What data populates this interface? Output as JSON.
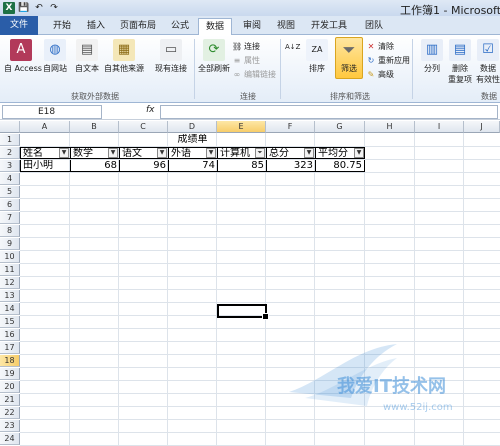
{
  "window": {
    "title": "工作簿1 - Microsoft"
  },
  "tabs": [
    "文件",
    "开始",
    "插入",
    "页面布局",
    "公式",
    "数据",
    "审阅",
    "视图",
    "开发工具",
    "团队"
  ],
  "ribbon": {
    "external": {
      "access": "自 Access",
      "web": "自网站",
      "text": "自文本",
      "other": "自其他来源",
      "existing": "现有连接",
      "group": "获取外部数据"
    },
    "connections": {
      "refresh": "全部刷新",
      "connect": "连接",
      "props": "属性",
      "editlinks": "编辑链接",
      "group": "连接"
    },
    "sort": {
      "sort": "排序",
      "filter": "筛选",
      "clear": "清除",
      "reapply": "重新应用",
      "advanced": "高级",
      "group": "排序和筛选"
    },
    "tools": {
      "split": "分列",
      "dedupe1": "删除",
      "dedupe2": "重复项",
      "valid1": "数据",
      "valid2": "有效性",
      "group": "数据"
    }
  },
  "formula_bar": {
    "cell_ref": "E18",
    "fx": "fx",
    "content": ""
  },
  "columns": [
    "A",
    "B",
    "C",
    "D",
    "E",
    "F",
    "G",
    "H",
    "I",
    "J"
  ],
  "rows": [
    "1",
    "2",
    "3",
    "4",
    "5",
    "6",
    "7",
    "8",
    "9",
    "10",
    "11",
    "12",
    "13",
    "14",
    "15",
    "16",
    "17",
    "18",
    "19",
    "20",
    "21",
    "22",
    "23",
    "24"
  ],
  "sheet": {
    "title": "成绩单",
    "headers": [
      "姓名",
      "数学",
      "语文",
      "外语",
      "计算机",
      "总分",
      "平均分"
    ],
    "row": {
      "name": "田小明",
      "math": "68",
      "chinese": "96",
      "english": "74",
      "computer": "85",
      "total": "323",
      "average": "80.75"
    }
  },
  "watermark": {
    "text": "我爱IT技术网",
    "url": "www.52ij.com"
  },
  "colors": {
    "file_tab": "#2a5da8",
    "filter_active": "#ffc83e",
    "watermark": "#3f8fd8"
  }
}
